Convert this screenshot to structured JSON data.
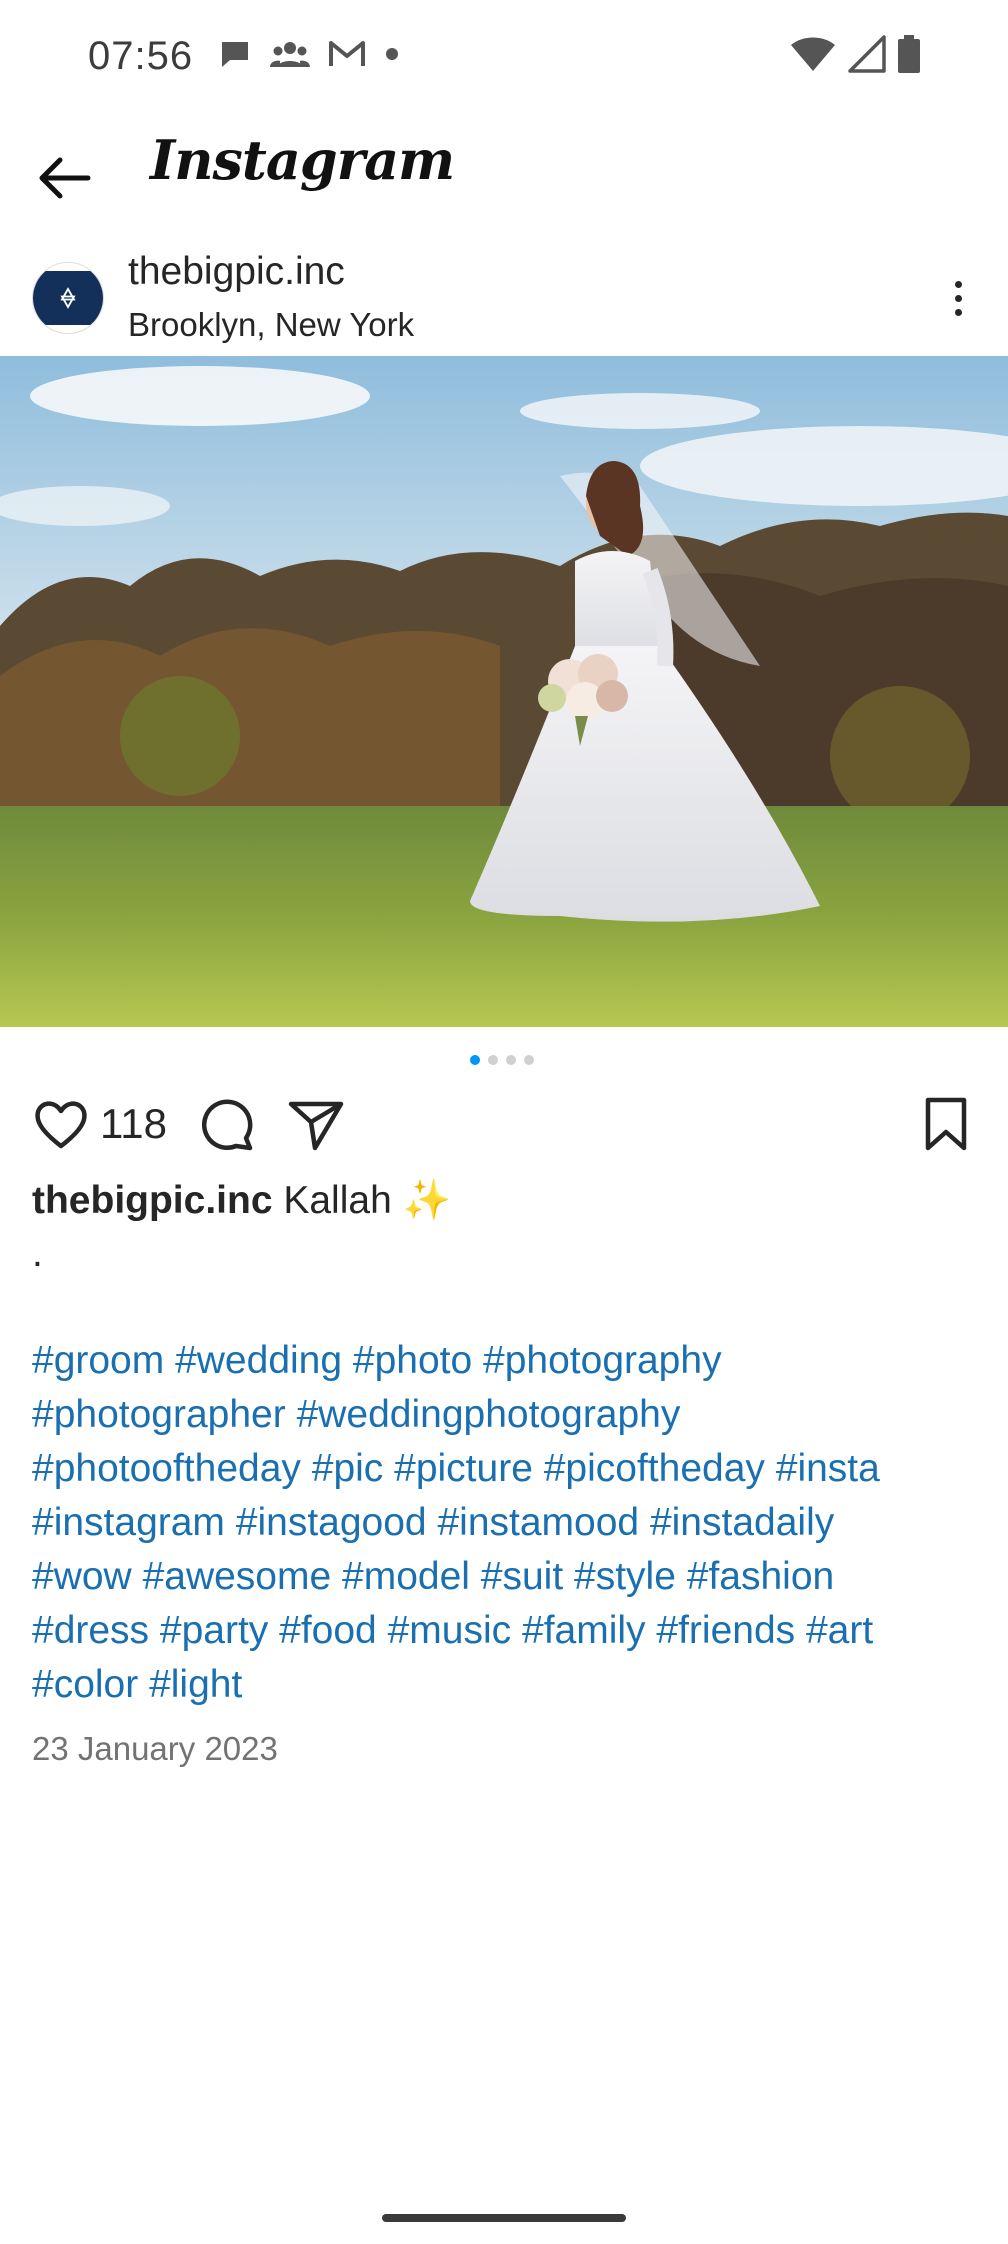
{
  "status_bar": {
    "time": "07:56",
    "left_icons": [
      "chat-bubble-icon",
      "group-icon",
      "gmail-icon",
      "dot-icon"
    ],
    "right_icons": [
      "wifi-icon",
      "signal-icon",
      "battery-icon"
    ]
  },
  "header": {
    "brand": "Instagram"
  },
  "post": {
    "username": "thebigpic.inc",
    "location": "Brooklyn, New York",
    "like_count": "118",
    "carousel": {
      "current": 1,
      "total": 4
    },
    "caption_text": "Kallah ✨",
    "caption_line2": ".",
    "hashtag_lines": [
      [
        "#groom",
        "#wedding",
        "#photo",
        "#photography"
      ],
      [
        "#photographer",
        "#weddingphotography"
      ],
      [
        "#photooftheday",
        "#pic",
        "#picture",
        "#picoftheday",
        "#insta"
      ],
      [
        "#instagram",
        "#instagood",
        "#instamood",
        "#instadaily"
      ],
      [
        "#wow",
        "#awesome",
        "#model",
        "#suit",
        "#style",
        "#fashion"
      ],
      [
        "#dress",
        "#party",
        "#food",
        "#music",
        "#family",
        "#friends",
        "#art"
      ],
      [
        "#color",
        "#light"
      ]
    ],
    "date": "23 January 2023"
  },
  "colors": {
    "hashtag": "#1a6fb0",
    "active_dot": "#0095f6",
    "text": "#262626",
    "muted": "#737373"
  }
}
